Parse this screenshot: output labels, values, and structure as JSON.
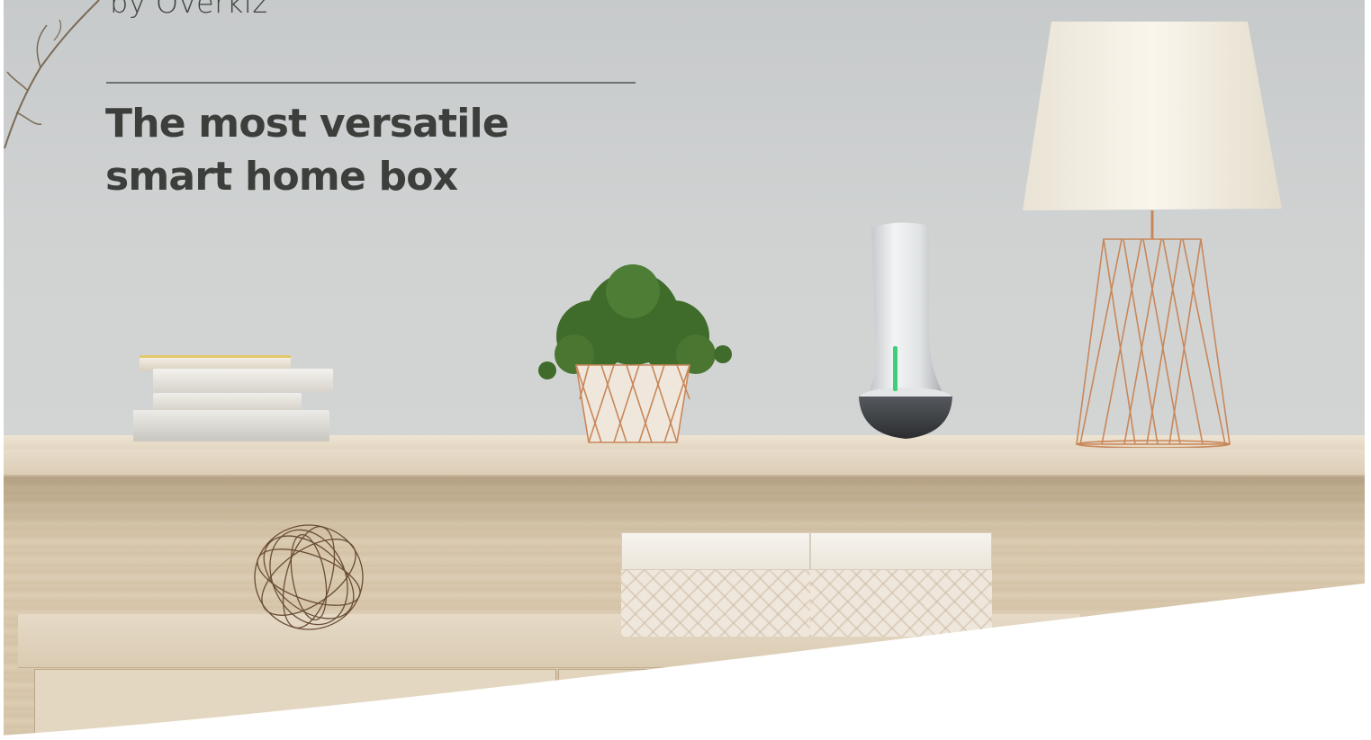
{
  "hero": {
    "brand_sub": "by Overkiz",
    "headline_line1": "The most versatile",
    "headline_line2": "smart home box"
  },
  "colors": {
    "headline": "#3b3e3a",
    "wall": "#d1d3d3",
    "wood": "#dccdb4",
    "copper": "#c8875a",
    "led": "#3ad17a"
  },
  "icons": {
    "device": "smart-home-box-icon",
    "lamp": "table-lamp-icon",
    "plant": "potted-plant-icon"
  }
}
